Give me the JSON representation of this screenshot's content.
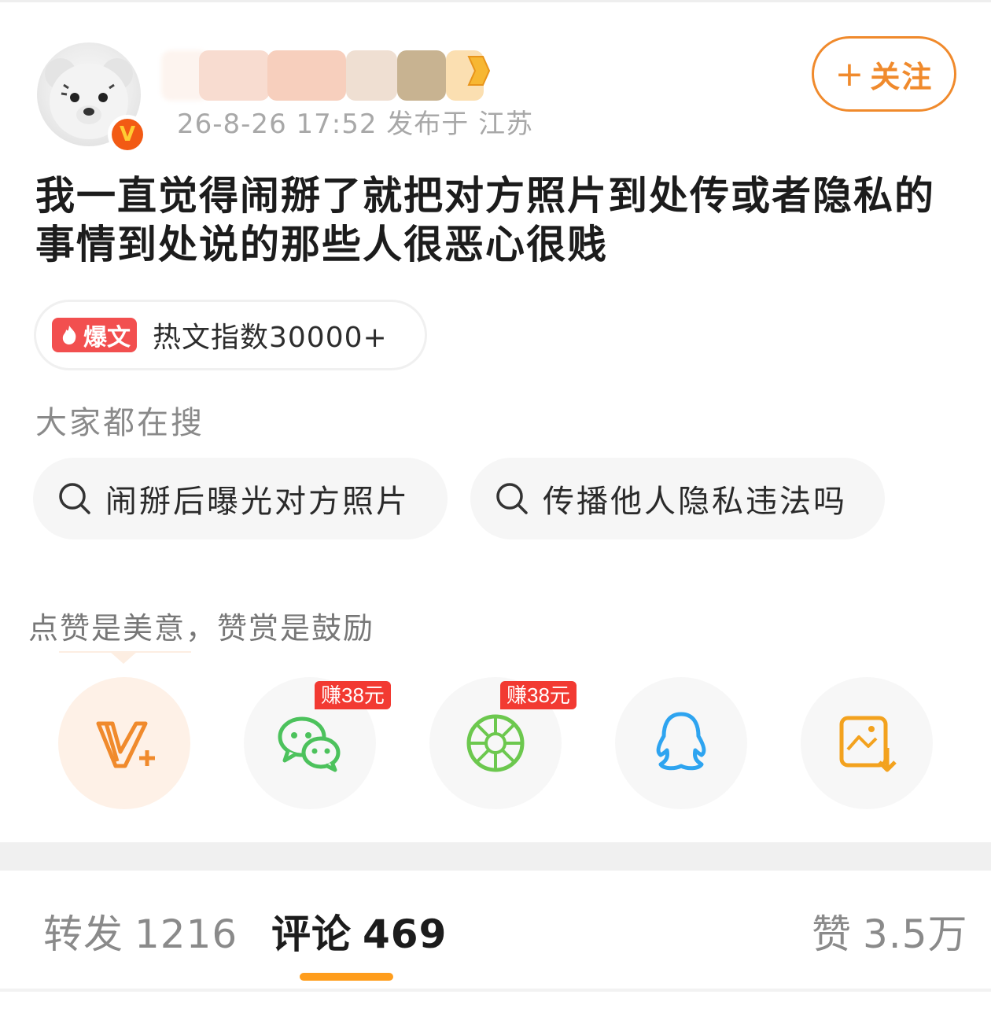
{
  "header": {
    "meta_text": "26-8-26 17:52  发布于 江苏",
    "follow_label": "关注",
    "follow_plus": "+",
    "verified_badge": "V"
  },
  "post": {
    "text": "我一直觉得闹掰了就把对方照片到处传或者隐私的事情到处说的那些人很恶心很贱"
  },
  "hot": {
    "tag_label": "爆文",
    "index_text": "热文指数30000+"
  },
  "search": {
    "title": "大家都在搜",
    "suggestions": [
      "闹掰后曝光对方照片",
      "传播他人隐私违法吗"
    ]
  },
  "reward": {
    "title": "点赞是美意，赞赏是鼓励"
  },
  "share": {
    "buttons": [
      {
        "icon": "reward-v-plus-icon"
      },
      {
        "icon": "wechat-icon",
        "badge": "赚38元"
      },
      {
        "icon": "moments-icon",
        "badge": "赚38元"
      },
      {
        "icon": "qq-icon"
      },
      {
        "icon": "save-image-icon"
      }
    ]
  },
  "tabs": {
    "repost_label": "转发",
    "repost_count": "1216",
    "comment_label": "评论",
    "comment_count": "469",
    "like_label": "赞",
    "like_count": "3.5万"
  },
  "colors": {
    "accent": "#f08a2c",
    "underline": "#ff9d1c",
    "wechat": "#4cc25c",
    "qq": "#2ea4f0",
    "badge_red": "#f23a32"
  }
}
